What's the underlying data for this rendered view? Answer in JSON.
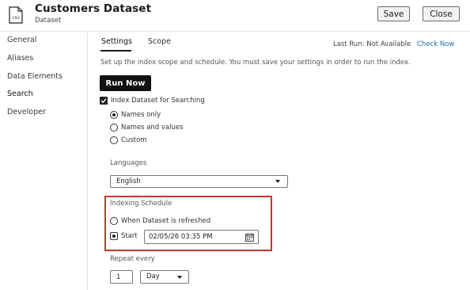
{
  "header": {
    "file_icon_text": "CSV",
    "title": "Customers Dataset",
    "subtitle": "Dataset",
    "save_label": "Save",
    "close_label": "Close"
  },
  "sidebar": {
    "items": [
      {
        "label": "General"
      },
      {
        "label": "Aliases"
      },
      {
        "label": "Data Elements"
      },
      {
        "label": "Search"
      },
      {
        "label": "Developer"
      }
    ],
    "active": "Search"
  },
  "tabs": [
    {
      "label": "Settings"
    },
    {
      "label": "Scope"
    }
  ],
  "active_tab": "Settings",
  "last_run": "Last Run: Not Available",
  "check_now": "Check Now",
  "description": "Set up the index scope and schedule. You must save your settings in order to run the index.",
  "run_now_label": "Run Now",
  "index_checkbox": {
    "label": "Index Dataset for Searching",
    "checked": true
  },
  "scope_options": [
    {
      "label": "Names only",
      "selected": true
    },
    {
      "label": "Names and values",
      "selected": false
    },
    {
      "label": "Custom",
      "selected": false
    }
  ],
  "languages": {
    "label": "Languages",
    "value": "English"
  },
  "indexing_schedule": {
    "label": "Indexing Schedule",
    "options": [
      {
        "label": "When Dataset is refreshed",
        "selected": false
      },
      {
        "label": "Start",
        "selected": true
      }
    ],
    "start_value": "02/05/26 03:35 PM"
  },
  "repeat": {
    "label": "Repeat every",
    "number": "1",
    "unit": "Day"
  },
  "colors": {
    "highlight_border": "#c0392b",
    "link": "#1e6aa0",
    "button_dark": "#111111"
  }
}
